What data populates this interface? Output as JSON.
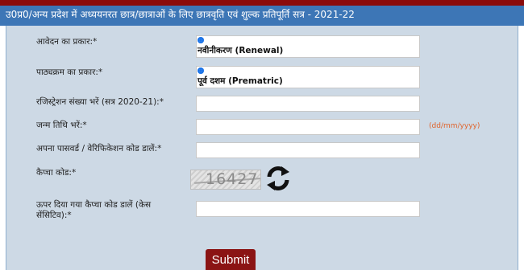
{
  "header": {
    "title": "उ0प्र0/अन्य प्रदेश में अध्ययनरत छात्र/छात्राओं के लिए छात्रवृति एवं शुल्क प्रतिपूर्ति सत्र - 2021-22"
  },
  "form": {
    "application_type": {
      "label": "आवेदन का प्रकार:*",
      "selected_option": "नवीनीकरण (Renewal)"
    },
    "course_type": {
      "label": "पाठ्यक्रम का प्रकार:*",
      "selected_option": "पूर्व दशम (Prematric)"
    },
    "registration_number": {
      "label": "रजिस्ट्रेशन संख्या भरें (सत्र 2020-21):*",
      "value": "",
      "placeholder": ""
    },
    "date_of_birth": {
      "label": "जन्म तिथि भरें:*",
      "value": "",
      "placeholder": "",
      "hint": "(dd/mm/yyyy)"
    },
    "password": {
      "label": "अपना पासवर्ड / वेरिफिकेशन कोड डालें:*",
      "value": "",
      "placeholder": ""
    },
    "captcha": {
      "label": "कैप्चा कोड:*",
      "code": "16427",
      "refresh_icon": "refresh-icon"
    },
    "captcha_input": {
      "label": "ऊपर दिया गया कैप्चा कोड डालें (केस सेंसिटिव):*",
      "value": "",
      "placeholder": ""
    },
    "submit_label": "Submit"
  },
  "colors": {
    "top_bar": "#8b0b0b",
    "header_bg": "#3d76b6",
    "panel_bg": "#cdd9e5",
    "hint": "#e0632a",
    "submit_bg": "#8b1414"
  }
}
